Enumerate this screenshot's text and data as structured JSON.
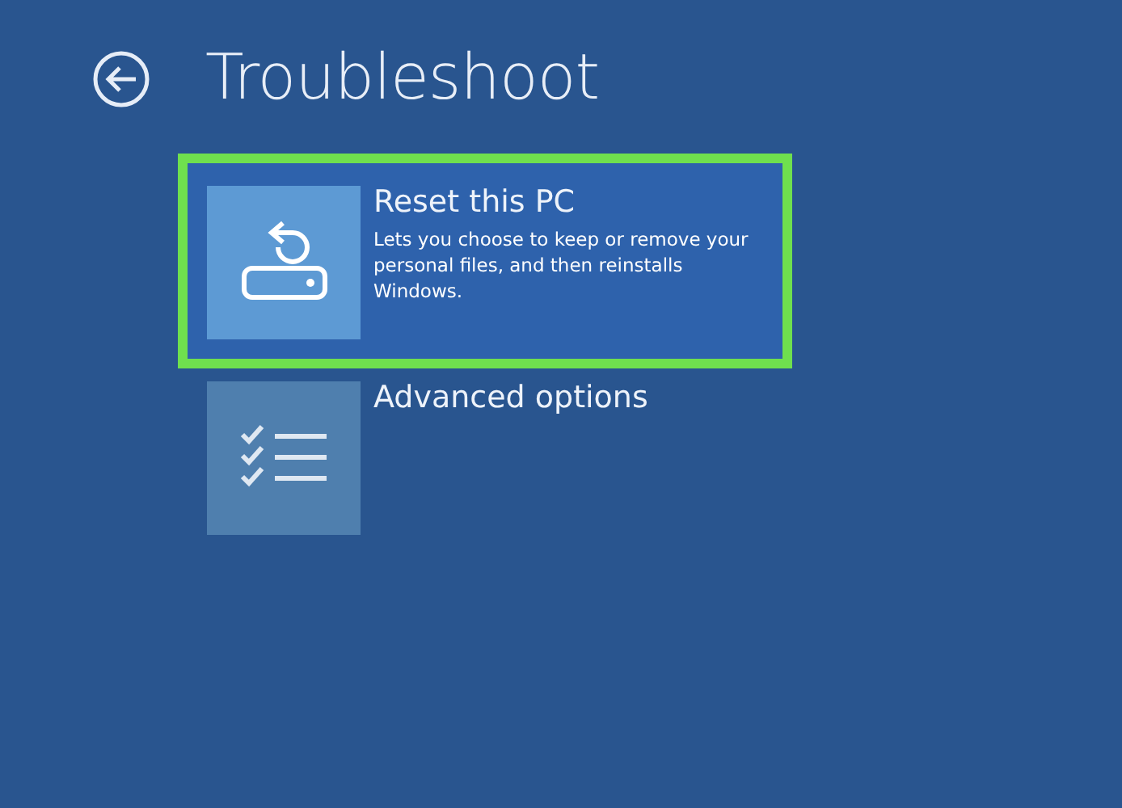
{
  "title": "Troubleshoot",
  "options": [
    {
      "kind": "reset",
      "label": "Reset this PC",
      "description": "Lets you choose to keep or remove your personal files, and then reinstalls Windows.",
      "selected": true
    },
    {
      "kind": "checklist",
      "label": "Advanced options",
      "selected": false
    }
  ]
}
